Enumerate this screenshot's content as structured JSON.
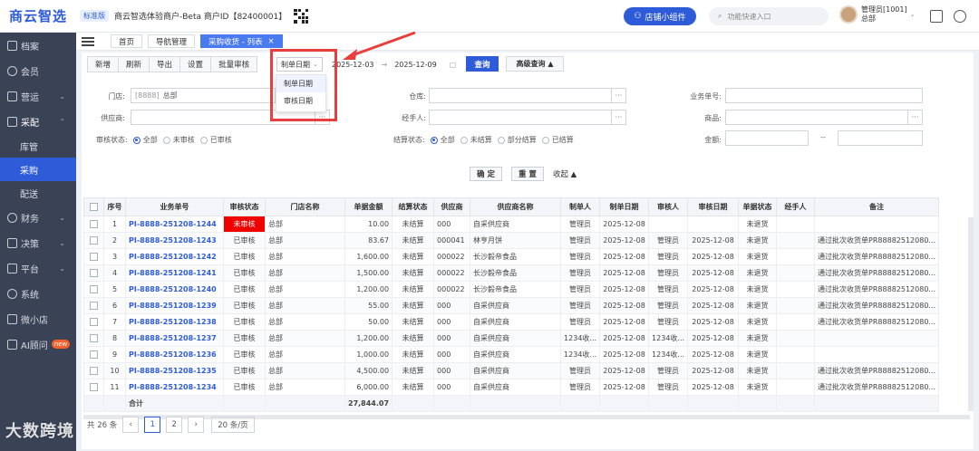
{
  "brand": {
    "logo_text": "商云智选",
    "edition": "标准版",
    "tenant": "商云智选体验商户-Beta   商户ID【82400001】"
  },
  "header": {
    "widget_button": "店铺小组件",
    "search_placeholder": "功能快速入口",
    "user_name": "管理员[1001]",
    "user_org": "总部"
  },
  "sidebar": {
    "items": [
      {
        "label": "档案"
      },
      {
        "label": "会员"
      },
      {
        "label": "营运"
      },
      {
        "label": "采配"
      },
      {
        "label": "财务"
      },
      {
        "label": "决策"
      },
      {
        "label": "平台"
      },
      {
        "label": "系统"
      },
      {
        "label": "微小店"
      },
      {
        "label": "AI顾问",
        "badge": "new"
      }
    ],
    "sub_items": [
      {
        "label": "库管"
      },
      {
        "label": "采购"
      },
      {
        "label": "配送"
      }
    ]
  },
  "tabs": [
    {
      "label": "首页"
    },
    {
      "label": "导航管理"
    },
    {
      "label": "采购收货 - 列表",
      "close": "×"
    }
  ],
  "toolbar": {
    "buttons": [
      "新增",
      "刷新",
      "导出",
      "设置",
      "批量审核"
    ],
    "date_type": "制单日期",
    "date_from": "2025-12-03",
    "date_sep": "→",
    "date_to": "2025-12-09",
    "query": "查询",
    "advanced": "高级查询 ▲"
  },
  "date_dropdown": {
    "options": [
      "制单日期",
      "审核日期"
    ]
  },
  "filters": {
    "store_label": "门店:",
    "store_code": "[8888]",
    "store_value": "总部",
    "warehouse_label": "仓库:",
    "bill_no_label": "业务单号:",
    "supplier_label": "供应商:",
    "handler_label": "经手人:",
    "product_label": "商品:",
    "audit_status_label": "审核状态:",
    "audit_options": [
      "全部",
      "未审核",
      "已审核"
    ],
    "settle_status_label": "结算状态:",
    "settle_options": [
      "全部",
      "未结算",
      "部分结算",
      "已结算"
    ],
    "amount_label": "金额:",
    "amount_sep": "--",
    "ellipsis": "···",
    "confirm": "确 定",
    "reset": "重 置",
    "collapse": "收起 ▲"
  },
  "table": {
    "columns": [
      "序号",
      "业务单号",
      "审核状态",
      "门店名称",
      "单据金额",
      "结算状态",
      "供应商",
      "供应商名称",
      "制单人",
      "制单日期",
      "审核人",
      "审核日期",
      "单据状态",
      "经手人",
      "备注"
    ],
    "rows": [
      [
        "1",
        "PI-8888-251208-1244",
        "未审核",
        "总部",
        "10.00",
        "未结算",
        "000",
        "自采供应商",
        "管理员",
        "2025-12-08",
        "",
        "",
        "未退货",
        "",
        ""
      ],
      [
        "2",
        "PI-8888-251208-1243",
        "已审核",
        "总部",
        "83.67",
        "未结算",
        "000041",
        "林亨月饼",
        "管理员",
        "2025-12-08",
        "管理员",
        "2025-12-08",
        "未退货",
        "",
        "通过批次收货单PR88882512080..."
      ],
      [
        "3",
        "PI-8888-251208-1242",
        "已审核",
        "总部",
        "1,600.00",
        "未结算",
        "000022",
        "长沙毅帝食品",
        "管理员",
        "2025-12-08",
        "管理员",
        "2025-12-08",
        "未退货",
        "",
        "通过批次收货单PR88882512080..."
      ],
      [
        "4",
        "PI-8888-251208-1241",
        "已审核",
        "总部",
        "1,500.00",
        "未结算",
        "000022",
        "长沙毅帝食品",
        "管理员",
        "2025-12-08",
        "管理员",
        "2025-12-08",
        "未退货",
        "",
        "通过批次收货单PR88882512080..."
      ],
      [
        "5",
        "PI-8888-251208-1240",
        "已审核",
        "总部",
        "1,200.00",
        "未结算",
        "000022",
        "长沙毅帝食品",
        "管理员",
        "2025-12-08",
        "管理员",
        "2025-12-08",
        "未退货",
        "",
        "通过批次收货单PR88882512080..."
      ],
      [
        "6",
        "PI-8888-251208-1239",
        "已审核",
        "总部",
        "55.00",
        "未结算",
        "000",
        "自采供应商",
        "管理员",
        "2025-12-08",
        "管理员",
        "2025-12-08",
        "未退货",
        "",
        "通过批次收货单PR88882512080..."
      ],
      [
        "7",
        "PI-8888-251208-1238",
        "已审核",
        "总部",
        "50.00",
        "未结算",
        "000",
        "自采供应商",
        "管理员",
        "2025-12-08",
        "管理员",
        "2025-12-08",
        "未退货",
        "",
        "通过批次收货单PR88882512080..."
      ],
      [
        "8",
        "PI-8888-251208-1237",
        "已审核",
        "总部",
        "1,200.00",
        "未结算",
        "000",
        "自采供应商",
        "1234收...",
        "2025-12-08",
        "1234收...",
        "2025-12-08",
        "未退货",
        "",
        ""
      ],
      [
        "9",
        "PI-8888-251208-1236",
        "已审核",
        "总部",
        "1,000.00",
        "未结算",
        "000",
        "自采供应商",
        "1234收...",
        "2025-12-08",
        "1234收...",
        "2025-12-08",
        "未退货",
        "",
        ""
      ],
      [
        "10",
        "PI-8888-251208-1235",
        "已审核",
        "总部",
        "4,500.00",
        "未结算",
        "000",
        "自采供应商",
        "管理员",
        "2025-12-08",
        "管理员",
        "2025-12-08",
        "未退货",
        "",
        "通过批次收货单PR88882512080..."
      ],
      [
        "11",
        "PI-8888-251208-1234",
        "已审核",
        "总部",
        "6,000.00",
        "未结算",
        "000",
        "自采供应商",
        "管理员",
        "2025-12-08",
        "管理员",
        "2025-12-08",
        "未退货",
        "",
        "通过批次收货单PR88882512080..."
      ]
    ],
    "total_label": "合计",
    "total_amount": "27,844.07"
  },
  "pagination": {
    "summary": "共 26 条",
    "prev": "‹",
    "pages": [
      "1",
      "2"
    ],
    "next": "›",
    "page_size": "20 条/页"
  },
  "watermark": "大数跨境",
  "colors": {
    "accent": "#2e5bd8",
    "unaudited": "#f10000",
    "sidebar": "#3a4256",
    "highlight_box": "#e83e3e"
  }
}
